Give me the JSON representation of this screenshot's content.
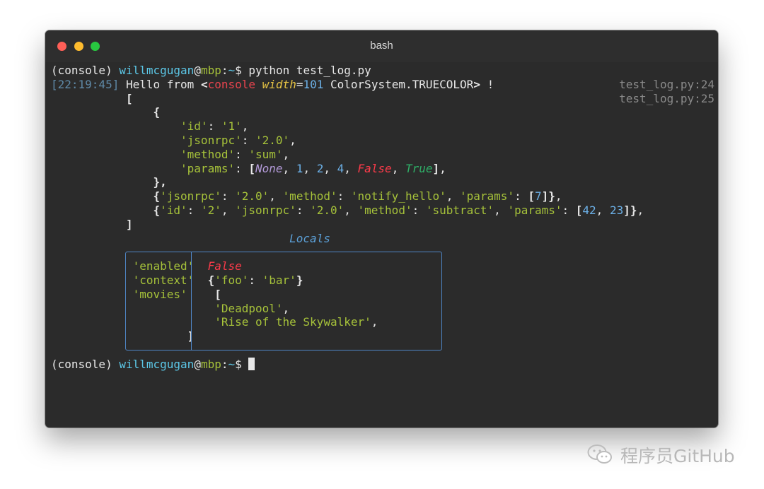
{
  "window": {
    "title": "bash"
  },
  "prompt": {
    "env": "(console)",
    "user": "willmcgugan",
    "at": "@",
    "host": "mbp",
    "sep": ":",
    "path": "~",
    "symbol": "$"
  },
  "command": "python test_log.py",
  "log": {
    "timestamp": "[22:19:45]",
    "hello": "Hello from",
    "lt": "<",
    "obj": "console",
    "attr": "width",
    "eq": "=",
    "width_val": "101",
    "colorsys": "ColorSystem.TRUECOLOR",
    "gt": ">",
    "bang": "!",
    "src1": "test_log.py:24",
    "src2": "test_log.py:25"
  },
  "json_lines": {
    "open_bracket": "[",
    "open_brace": "{",
    "k_id": "'id'",
    "v_id": "'1'",
    "k_jsonrpc": "'jsonrpc'",
    "v_jsonrpc": "'2.0'",
    "k_method": "'method'",
    "v_method": "'sum'",
    "k_params": "'params'",
    "none": "None",
    "n1": "1",
    "n2": "2",
    "n4": "4",
    "false": "False",
    "true": "True",
    "close_brace": "},",
    "v_notify": "'notify_hello'",
    "n7": "7",
    "v_id2": "'2'",
    "v_subtract": "'subtract'",
    "n42": "42",
    "n23": "23",
    "close_bracket": "]"
  },
  "locals": {
    "title": "Locals",
    "k_enabled": "'enabled'",
    "k_context": "'context'",
    "k_movies": "'movies'",
    "v_enabled": "False",
    "ctx_key": "'foo'",
    "ctx_val": "'bar'",
    "movie1": "'Deadpool'",
    "movie2": "'Rise of the Skywalker'",
    "open_bracket": "[",
    "close_bracket": "]"
  },
  "watermark": {
    "text": "程序员GitHub",
    "icon": "wechat-icon"
  }
}
